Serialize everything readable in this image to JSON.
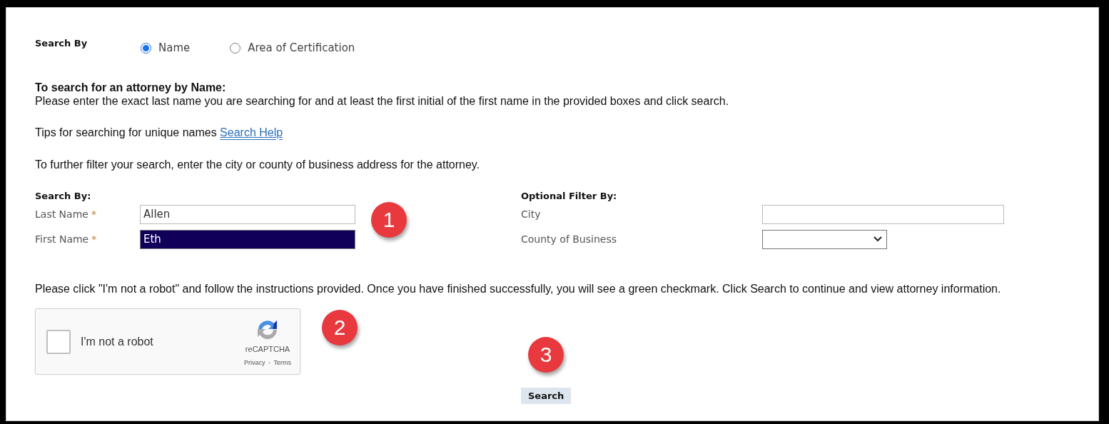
{
  "search_by": {
    "label": "Search By",
    "options": [
      {
        "label": "Name",
        "selected": true
      },
      {
        "label": "Area of Certification",
        "selected": false
      }
    ]
  },
  "instructions": {
    "heading": "To search for an attorney by Name:",
    "text": "Please enter the exact last name you are searching for and at least the first initial of the first name in the provided boxes and click search.",
    "tips": "Tips for searching for unique names",
    "help_link": "Search Help",
    "filter_note": "To further filter your search, enter the city or county of business address for the attorney."
  },
  "name_fields": {
    "title": "Search By:",
    "fields": [
      {
        "label": "Last Name",
        "required_mark": "*",
        "value": "Allen",
        "selected": false
      },
      {
        "label": "First Name",
        "required_mark": "*",
        "value": "Eth",
        "selected": true
      }
    ]
  },
  "optional_filter": {
    "title": "Optional Filter By:",
    "fields": [
      {
        "label": "City",
        "kind": "text"
      },
      {
        "label": "County of Business",
        "kind": "select"
      }
    ]
  },
  "robot_note": "Please click \"I'm not a robot\" and follow the instructions provided.  Once you have finished successfully, you will see a green checkmark. Click Search to continue and view attorney information.",
  "captcha": {
    "label": "I'm not a robot",
    "checked": false,
    "brand": "reCAPTCHA",
    "privacy": "Privacy",
    "separator": "-",
    "terms": "Terms"
  },
  "annotations": [
    "1",
    "2",
    "3"
  ],
  "search_button": "Search"
}
